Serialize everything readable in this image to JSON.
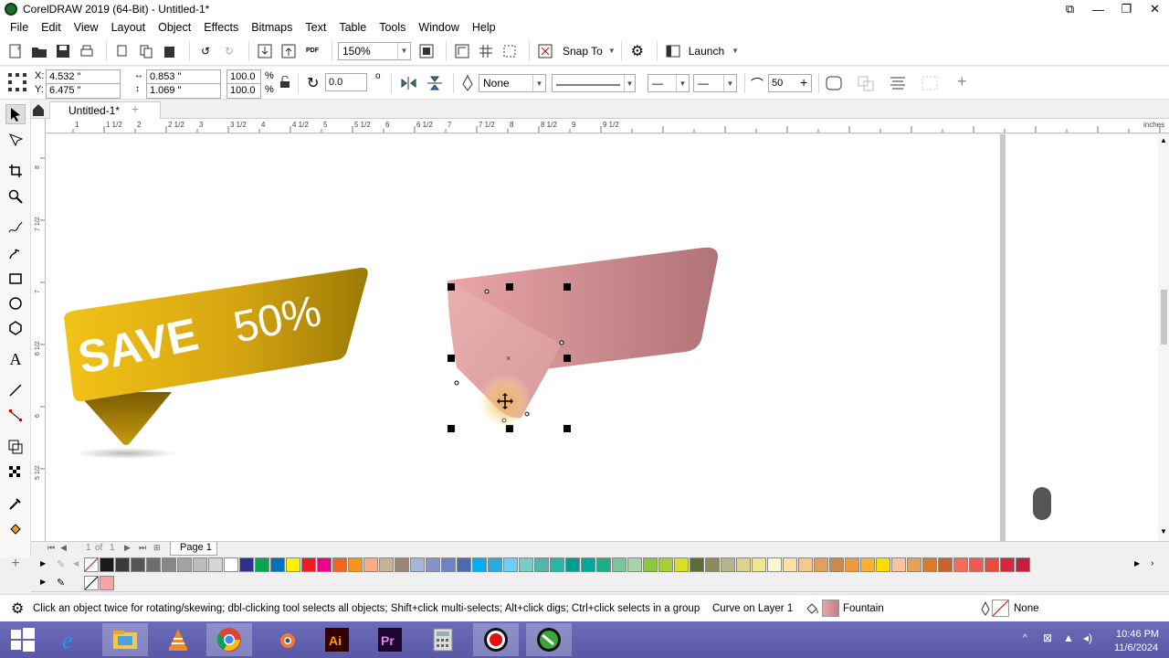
{
  "window": {
    "title": "CorelDRAW 2019 (64-Bit) - Untitled-1*"
  },
  "menu": [
    "File",
    "Edit",
    "View",
    "Layout",
    "Object",
    "Effects",
    "Bitmaps",
    "Text",
    "Table",
    "Tools",
    "Window",
    "Help"
  ],
  "toolbar": {
    "zoom": "150%",
    "snap_label": "Snap To",
    "launch_label": "Launch"
  },
  "property_bar": {
    "x_label": "X:",
    "x_value": "4.532 \"",
    "y_label": "Y:",
    "y_value": "6.475 \"",
    "width": "0.853 \"",
    "height": "1.069 \"",
    "scale_x": "100.0",
    "scale_y": "100.0",
    "percent": "%",
    "rotation": "0.0",
    "degree": "o",
    "outline": "None",
    "smoothing": "50"
  },
  "doc_tab": "Untitled-1*",
  "ruler": {
    "top": [
      "1",
      "1 1/2",
      "2",
      "2 1/2",
      "3",
      "3 1/2",
      "4",
      "4 1/2",
      "5",
      "5 1/2",
      "6",
      "6 1/2",
      "7",
      "7 1/2",
      "8",
      "8 1/2",
      "9",
      "9 1/2"
    ],
    "unit": "inches",
    "left": [
      "8",
      "7 1/2",
      "7",
      "6 1/2",
      "6",
      "5 1/2"
    ]
  },
  "canvas": {
    "banner_text_1": "SAVE",
    "banner_text_2": "50%"
  },
  "page_nav": {
    "counter": "1",
    "of": "of",
    "total": "1",
    "page_tab": "Page 1"
  },
  "status": {
    "hint": "Click an object twice for rotating/skewing; dbl-clicking tool selects all objects; Shift+click multi-selects; Alt+click digs; Ctrl+click selects in a group",
    "object": "Curve on Layer 1",
    "fill_label": "Fountain",
    "outline_label": "None"
  },
  "taskbar": {
    "time": "10:46 PM",
    "date": "11/6/2024",
    "apps": [
      "windows-start",
      "internet-explorer",
      "file-explorer",
      "vlc",
      "chrome",
      "blender",
      "illustrator",
      "premiere",
      "calculator",
      "recorder",
      "coreldraw"
    ]
  },
  "palette_colors": [
    "#1a1a1a",
    "#3b3b3b",
    "#555555",
    "#6e6e6e",
    "#888888",
    "#a2a2a2",
    "#bcbcbc",
    "#d6d6d6",
    "#ffffff",
    "#2e3192",
    "#00a651",
    "#0072bc",
    "#fff200",
    "#ed1c24",
    "#ec008c",
    "#f26522",
    "#f7941d",
    "#f9ad81",
    "#c7b299",
    "#998675",
    "#a3b6d9",
    "#8493ca",
    "#6d83c4",
    "#4a6ab1",
    "#00aeef",
    "#29abe2",
    "#6dcff6",
    "#7accc8",
    "#4fb7aa",
    "#2bb5a3",
    "#009e8f",
    "#00a99d",
    "#1aaf86",
    "#78c79c",
    "#a7d5a7",
    "#8cc63f",
    "#a6ce39",
    "#d7e025",
    "#606c38",
    "#8c8c5a",
    "#b5b58a",
    "#ddd28b",
    "#f0e68c",
    "#fbf7d1",
    "#ffe0a3",
    "#f7c78c",
    "#e0a15e",
    "#c98a4b",
    "#ec9a3c",
    "#f8b133",
    "#ffdd00",
    "#f7c59f",
    "#e6a15a",
    "#d97b29",
    "#c9622b",
    "#f46b57",
    "#ee5a5a",
    "#e84c3d",
    "#d7263d",
    "#c21f3a"
  ],
  "colors": {
    "accent_select": "#000000",
    "banner_gold": "#e2b31a",
    "banner_pink": "#d59ba0",
    "taskbar": "#5f5fae"
  }
}
